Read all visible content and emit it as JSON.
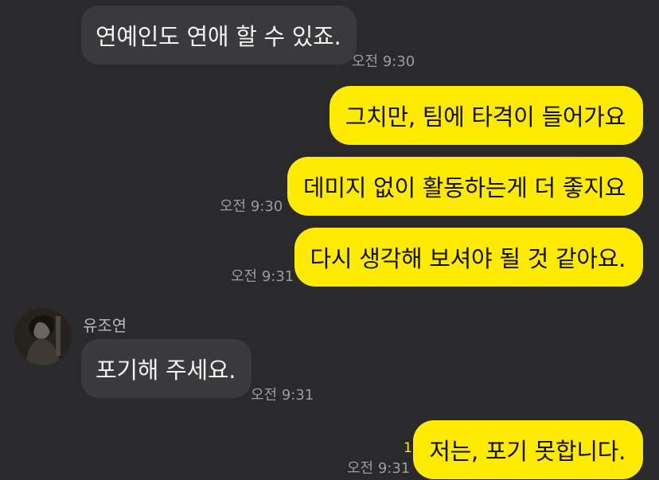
{
  "chat": {
    "messages": [
      {
        "text": "연예인도 연애 할 수 있죠.",
        "time": "오전 9:30"
      },
      {
        "text": "그치만, 팀에 타격이 들어가요"
      },
      {
        "text": "데미지 없이 활동하는게 더 좋지요",
        "time": "오전 9:30"
      },
      {
        "text": "다시 생각해 보셔야 될 것 같아요.",
        "time": "오전 9:31"
      },
      {
        "sender": "유조연",
        "text": "포기해 주세요.",
        "time": "오전 9:31"
      },
      {
        "text": "저는, 포기 못합니다.",
        "time": "오전 9:31",
        "unread": "1"
      }
    ]
  },
  "colors": {
    "background": "#2a2a2d",
    "incoming_bubble": "#3a3a3d",
    "outgoing_bubble": "#ffeb00",
    "timestamp": "#9c9c9f",
    "unread_count": "#ffeb00"
  },
  "icons": {
    "contact_avatar": "profile-photo-avatar"
  }
}
